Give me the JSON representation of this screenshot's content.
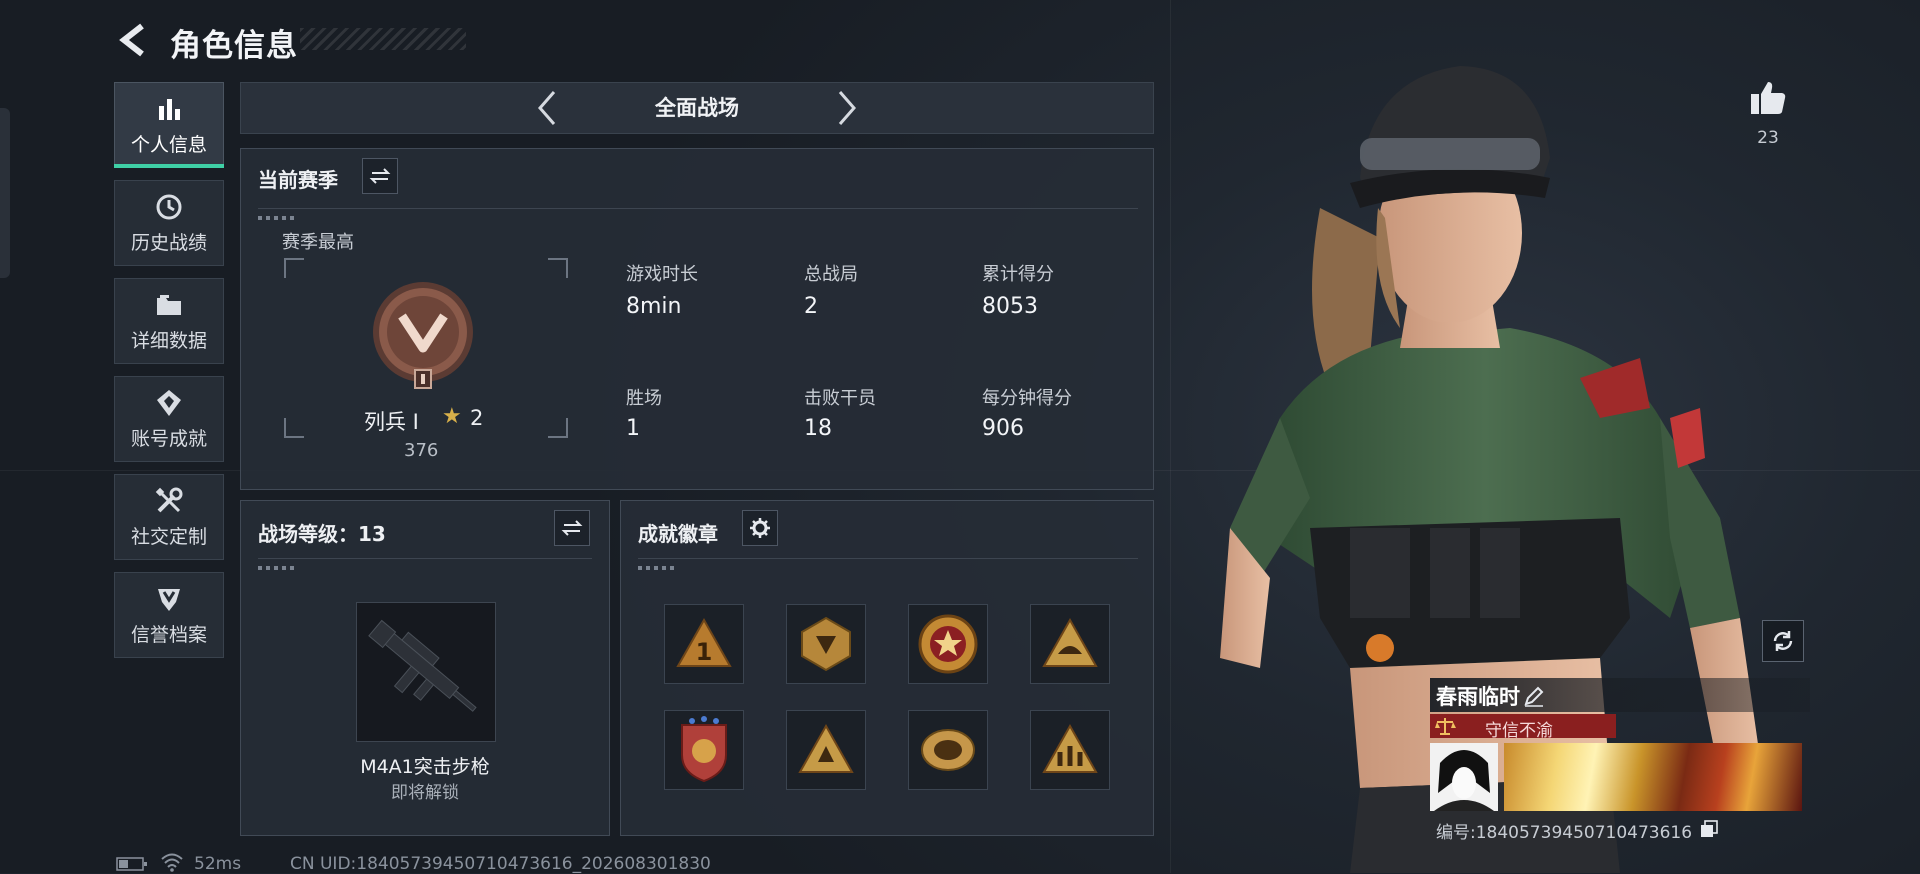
{
  "header": {
    "title": "角色信息"
  },
  "nav": {
    "items": [
      {
        "label": "个人信息",
        "icon": "bar-chart-icon",
        "active": true
      },
      {
        "label": "历史战绩",
        "icon": "history-clock-icon",
        "active": false
      },
      {
        "label": "详细数据",
        "icon": "folder-icon",
        "active": false
      },
      {
        "label": "账号成就",
        "icon": "achievement-badge-icon",
        "active": false
      },
      {
        "label": "社交定制",
        "icon": "wrench-screwdriver-icon",
        "active": false
      },
      {
        "label": "信誉档案",
        "icon": "shield-rank-icon",
        "active": false
      }
    ]
  },
  "mode": {
    "title": "全面战场"
  },
  "season": {
    "title": "当前赛季",
    "best_label": "赛季最高",
    "rank_name": "列兵 Ⅰ",
    "stars": "2",
    "rank_points": "376",
    "stats": [
      {
        "label": "游戏时长",
        "value": "8min"
      },
      {
        "label": "总战局",
        "value": "2"
      },
      {
        "label": "累计得分",
        "value": "8053"
      },
      {
        "label": "胜场",
        "value": "1"
      },
      {
        "label": "击败干员",
        "value": "18"
      },
      {
        "label": "每分钟得分",
        "value": "906"
      }
    ]
  },
  "battlefield_level": {
    "title": "战场等级：13",
    "weapon_name": "M4A1突击步枪",
    "weapon_status": "即将解锁"
  },
  "achievements": {
    "title": "成就徽章",
    "badges": [
      "badge-1",
      "badge-2",
      "badge-3",
      "badge-4",
      "badge-5",
      "badge-6",
      "badge-7",
      "badge-8"
    ]
  },
  "profile": {
    "likes": "23",
    "player_name": "春雨临时",
    "reputation": "守信不渝",
    "player_id": "编号:1840573945071047361​6"
  },
  "status_bar": {
    "ping": "52ms",
    "uid": "CN UID:1840573945071047361​6_202608301830"
  },
  "colors": {
    "accent": "#3fd0a6",
    "reputation_red": "#8a1f1f",
    "medal_bronze": "#8a5a4a"
  }
}
